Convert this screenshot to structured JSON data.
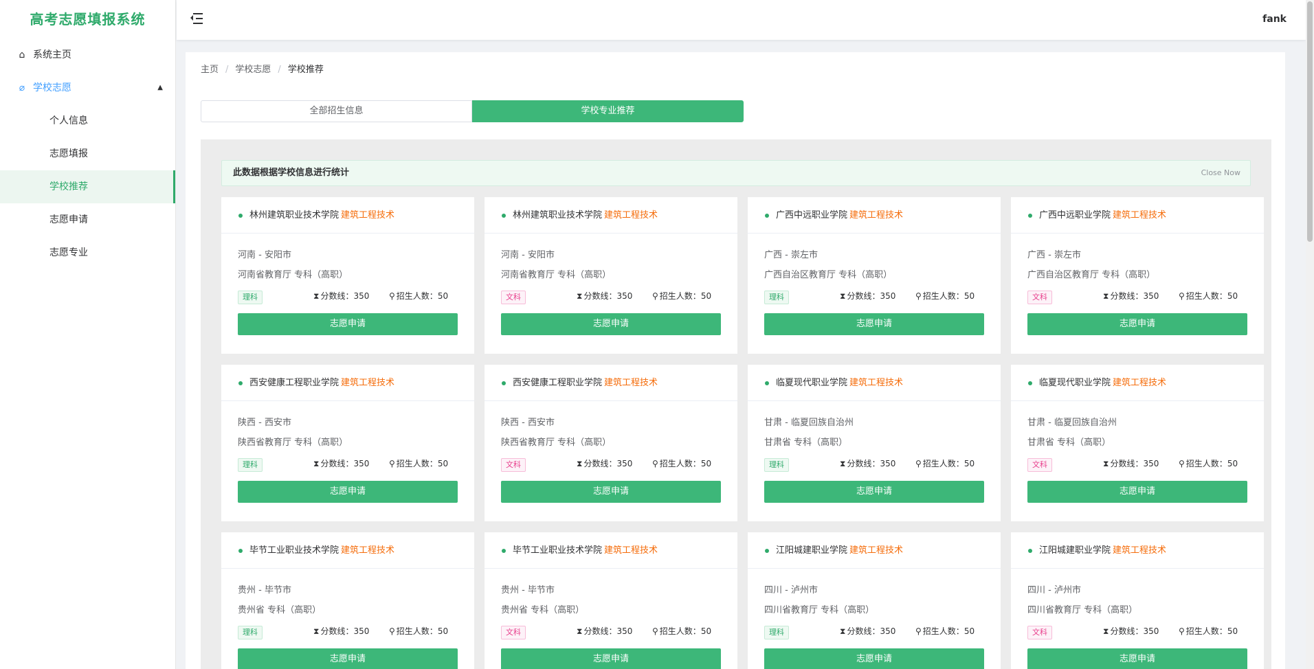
{
  "app": {
    "title": "高考志愿填报系统"
  },
  "sidebar": {
    "home": "系统主页",
    "group": "学校志愿",
    "sub": [
      "个人信息",
      "志愿填报",
      "学校推荐",
      "志愿申请",
      "志愿专业"
    ],
    "active_index": 2
  },
  "header": {
    "username": "fank"
  },
  "breadcrumb": [
    "主页",
    "学校志愿",
    "学校推荐"
  ],
  "tabs": [
    "全部招生信息",
    "学校专业推荐"
  ],
  "active_tab": 1,
  "alert": {
    "text": "此数据根据学校信息进行统计",
    "close": "Close Now"
  },
  "labels": {
    "score_label": "分数线：",
    "count_label": "招生人数：",
    "apply": "志愿申请"
  },
  "colors": {
    "primary": "#3db779",
    "major": "#f56c0a",
    "wen_tag": "#e83e8c",
    "li_tag": "#2faa6b"
  },
  "cards": [
    {
      "school": "林州建筑职业技术学院",
      "major": "建筑工程技术",
      "location": "河南 - 安阳市",
      "dept": "河南省教育厅 专科（高职）",
      "subject": "理科",
      "score": "350",
      "count": "50"
    },
    {
      "school": "林州建筑职业技术学院",
      "major": "建筑工程技术",
      "location": "河南 - 安阳市",
      "dept": "河南省教育厅 专科（高职）",
      "subject": "文科",
      "score": "350",
      "count": "50"
    },
    {
      "school": "广西中远职业学院",
      "major": "建筑工程技术",
      "location": "广西 - 崇左市",
      "dept": "广西自治区教育厅 专科（高职）",
      "subject": "理科",
      "score": "350",
      "count": "50"
    },
    {
      "school": "广西中远职业学院",
      "major": "建筑工程技术",
      "location": "广西 - 崇左市",
      "dept": "广西自治区教育厅 专科（高职）",
      "subject": "文科",
      "score": "350",
      "count": "50"
    },
    {
      "school": "西安健康工程职业学院",
      "major": "建筑工程技术",
      "location": "陕西 - 西安市",
      "dept": "陕西省教育厅 专科（高职）",
      "subject": "理科",
      "score": "350",
      "count": "50"
    },
    {
      "school": "西安健康工程职业学院",
      "major": "建筑工程技术",
      "location": "陕西 - 西安市",
      "dept": "陕西省教育厅 专科（高职）",
      "subject": "文科",
      "score": "350",
      "count": "50"
    },
    {
      "school": "临夏现代职业学院",
      "major": "建筑工程技术",
      "location": "甘肃 - 临夏回族自治州",
      "dept": "甘肃省 专科（高职）",
      "subject": "理科",
      "score": "350",
      "count": "50"
    },
    {
      "school": "临夏现代职业学院",
      "major": "建筑工程技术",
      "location": "甘肃 - 临夏回族自治州",
      "dept": "甘肃省 专科（高职）",
      "subject": "文科",
      "score": "350",
      "count": "50"
    },
    {
      "school": "毕节工业职业技术学院",
      "major": "建筑工程技术",
      "location": "贵州 - 毕节市",
      "dept": "贵州省 专科（高职）",
      "subject": "理科",
      "score": "350",
      "count": "50"
    },
    {
      "school": "毕节工业职业技术学院",
      "major": "建筑工程技术",
      "location": "贵州 - 毕节市",
      "dept": "贵州省 专科（高职）",
      "subject": "文科",
      "score": "350",
      "count": "50"
    },
    {
      "school": "江阳城建职业学院",
      "major": "建筑工程技术",
      "location": "四川 - 泸州市",
      "dept": "四川省教育厅 专科（高职）",
      "subject": "理科",
      "score": "350",
      "count": "50"
    },
    {
      "school": "江阳城建职业学院",
      "major": "建筑工程技术",
      "location": "四川 - 泸州市",
      "dept": "四川省教育厅 专科（高职）",
      "subject": "文科",
      "score": "350",
      "count": "50"
    }
  ]
}
